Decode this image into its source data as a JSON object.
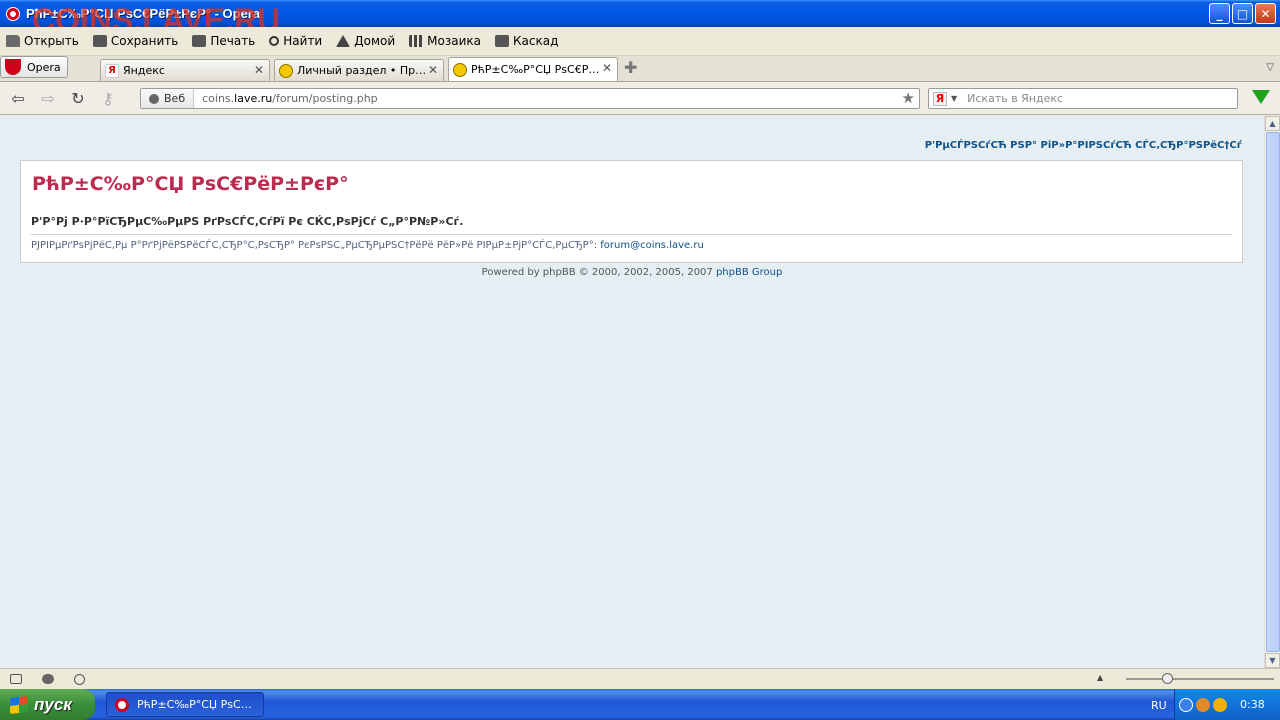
{
  "window": {
    "title": "РћР±С‰Р°СЏ РѕС€РёР±РєР° - Opera",
    "watermark": "COINS.LAVE.RU",
    "buttons": [
      "_",
      "□",
      "✕"
    ]
  },
  "toolbar": {
    "items": [
      {
        "label": "Открыть",
        "icon": "folder-icon"
      },
      {
        "label": "Сохранить",
        "icon": "save-icon"
      },
      {
        "label": "Печать",
        "icon": "print-icon"
      },
      {
        "label": "Найти",
        "icon": "search-icon"
      },
      {
        "label": "Домой",
        "icon": "home-icon"
      },
      {
        "label": "Мозаика",
        "icon": "tile-icon"
      },
      {
        "label": "Каскад",
        "icon": "cascade-icon"
      }
    ]
  },
  "tabs": {
    "menu_label": "Opera",
    "items": [
      {
        "label": "Яндекс",
        "fav": "Я"
      },
      {
        "label": "Личный раздел • Просм...",
        "fav": ""
      },
      {
        "label": "РћР±С‰Р°СЏ РѕС€РёР...",
        "fav": ""
      }
    ]
  },
  "address": {
    "badge": "Веб",
    "url_prefix": "coins.",
    "url_domain": "lave.ru",
    "url_path": "/forum/posting.php",
    "search_placeholder": "Искать в Яндекс",
    "search_engine": "Я"
  },
  "page": {
    "top_link": "Р'РµСЃРЅСѓСЋ РЅР° РіР»Р°РІРЅСѓСЋ СЃС‚СЂР°РЅРёС†Сѓ",
    "heading": "РћР±С‰Р°СЏ РѕС€РёР±РєР°",
    "message": "Р'Р°Рј Р·Р°РїСЂРµС‰РµРЅ РґРѕСЃС‚СѓРї Рє СЌС‚РѕРјСѓ С„Р°Р№Р»Сѓ.",
    "contact_text": "РЈРІРµРґРѕРјРёС‚Рµ Р°РґРјРёРЅРёСЃС‚СЂР°С‚РѕСЂР° РєРѕРЅС„РµСЂРµРЅС†РёРё РёР»Рё РІРµР±РјР°СЃС‚РµСЂР°: ",
    "contact_email": "forum@coins.lave.ru",
    "powered_prefix": "Powered by phpBB © 2000, 2002, 2005, 2007 ",
    "powered_link": "phpBB Group"
  },
  "taskbar": {
    "start_label": "пуск",
    "task_label": "РћР±С‰Р°СЏ РѕС€Р...",
    "lang": "RU",
    "clock": "0:38"
  },
  "colors": {
    "heading": "#BC2A4D",
    "link": "#105289",
    "page_bg": "#E5EEF2"
  }
}
